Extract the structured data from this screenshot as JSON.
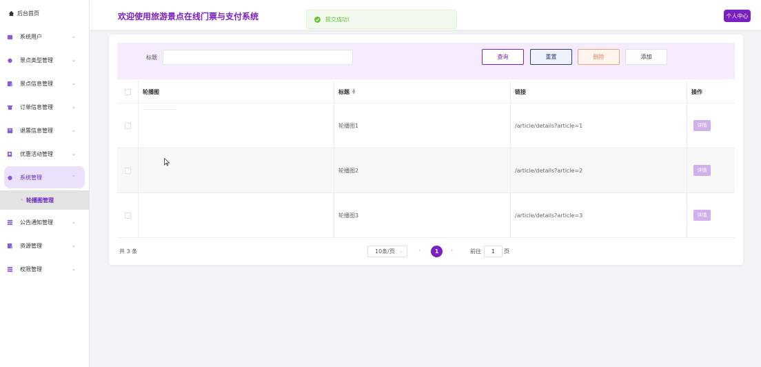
{
  "sidebar": {
    "home_label": "后台首页",
    "items": [
      {
        "label": "系统用户",
        "icon": "user-icon"
      },
      {
        "label": "景点类型管理",
        "icon": "tag-icon"
      },
      {
        "label": "景点信息管理",
        "icon": "document-icon"
      },
      {
        "label": "订单信息管理",
        "icon": "order-icon"
      },
      {
        "label": "退票信息管理",
        "icon": "refund-icon"
      },
      {
        "label": "优惠活动管理",
        "icon": "discount-icon"
      },
      {
        "label": "系统管理",
        "icon": "settings-icon"
      },
      {
        "label": "公告通知管理",
        "icon": "list-icon"
      },
      {
        "label": "资源管理",
        "icon": "resource-icon"
      },
      {
        "label": "权限管理",
        "icon": "list-icon"
      }
    ],
    "submenu_label": "轮播图管理"
  },
  "header": {
    "title": "欢迎使用旅游景点在线门票与支付系统",
    "toast": "提交成功!",
    "profile_label": "个人中心"
  },
  "search": {
    "title_label": "标题",
    "title_value": "",
    "query_label": "查询",
    "reset_label": "重置",
    "delete_label": "删除",
    "add_label": "添加"
  },
  "table": {
    "headers": [
      "轮播图",
      "标题",
      "链接",
      "操作"
    ],
    "rows": [
      {
        "title": "轮播图1",
        "link": "/article/details?article=1",
        "action": "详情"
      },
      {
        "title": "轮播图2",
        "link": "/article/details?article=2",
        "action": "详情"
      },
      {
        "title": "轮播图3",
        "link": "/article/details?article=3",
        "action": "详情"
      }
    ]
  },
  "pagination": {
    "total": "共 3 条",
    "page_size": "10条/页",
    "current_page": "1",
    "goto_prefix": "前往",
    "goto_value": "1",
    "goto_suffix": "页"
  },
  "colors": {
    "accent": "#7a1fc2",
    "toast_bg": "#f0f9eb",
    "toast_text": "#67c23a"
  }
}
